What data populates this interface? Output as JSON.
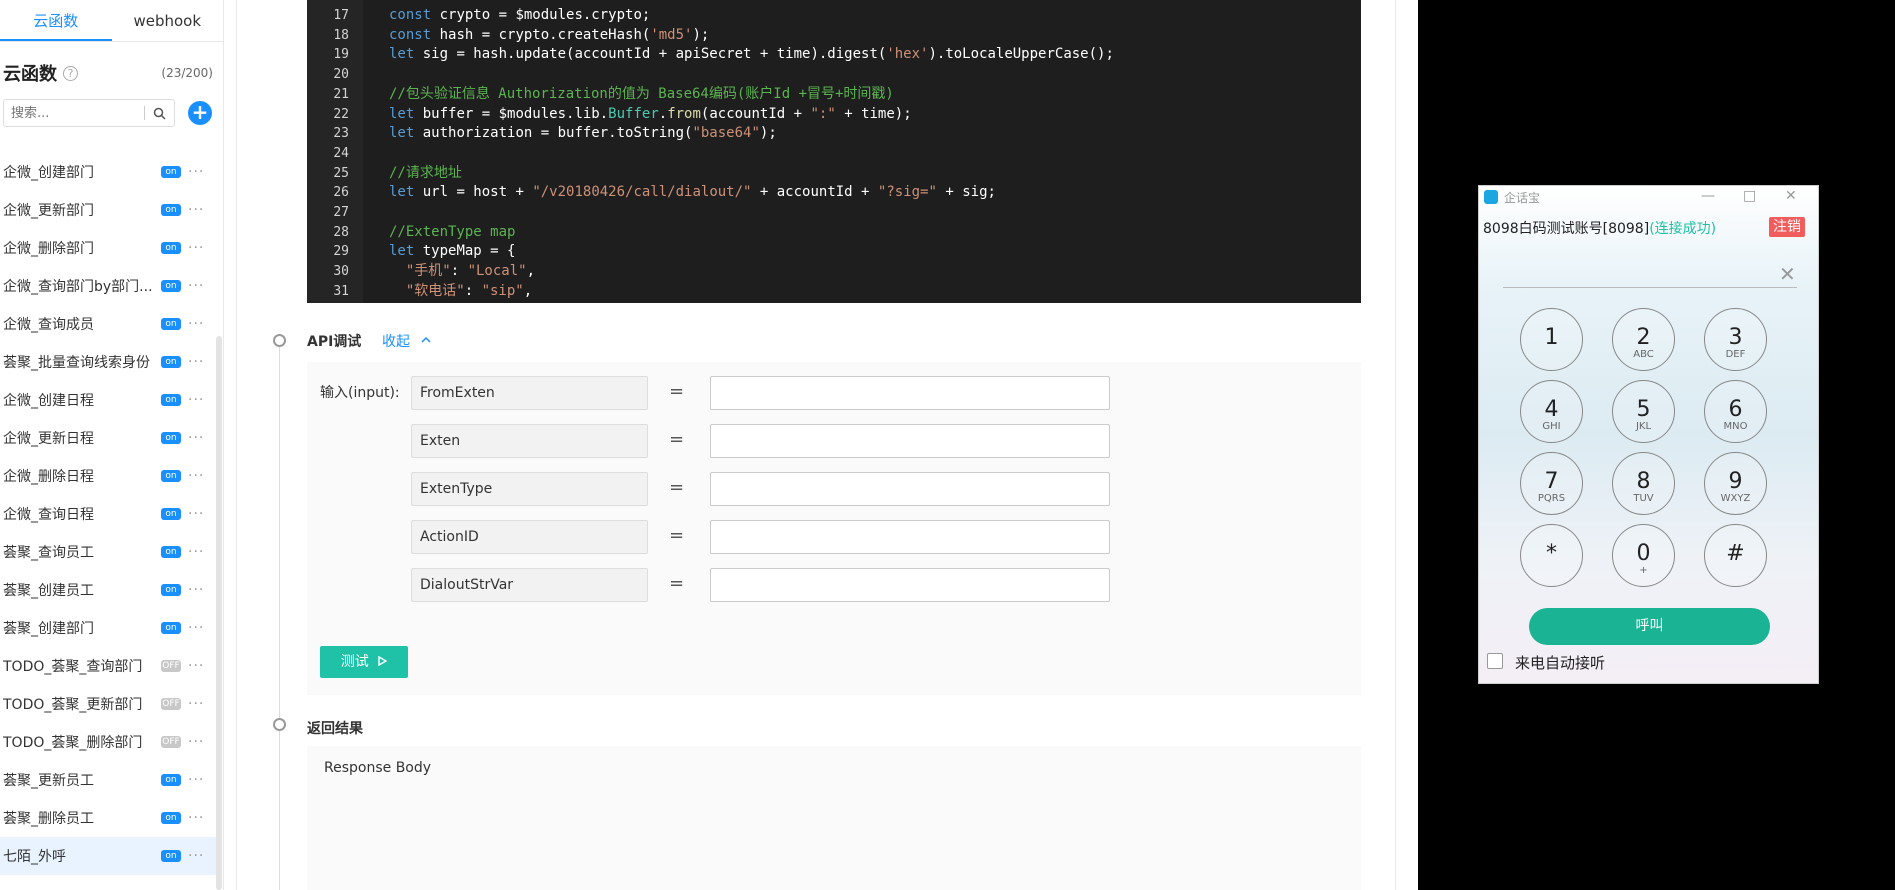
{
  "sidebar": {
    "tabs": [
      "云函数",
      "webhook"
    ],
    "title": "云函数",
    "help_icon": "?",
    "count": "(23/200)",
    "search_placeholder": "搜索...",
    "add_label": "+",
    "items": [
      {
        "label": "企微_创建部门",
        "status": "on"
      },
      {
        "label": "企微_更新部门",
        "status": "on"
      },
      {
        "label": "企微_删除部门",
        "status": "on"
      },
      {
        "label": "企微_查询部门by部门...",
        "status": "on"
      },
      {
        "label": "企微_查询成员",
        "status": "on"
      },
      {
        "label": "荟聚_批量查询线索身份",
        "status": "on"
      },
      {
        "label": "企微_创建日程",
        "status": "on"
      },
      {
        "label": "企微_更新日程",
        "status": "on"
      },
      {
        "label": "企微_删除日程",
        "status": "on"
      },
      {
        "label": "企微_查询日程",
        "status": "on"
      },
      {
        "label": "荟聚_查询员工",
        "status": "on"
      },
      {
        "label": "荟聚_创建员工",
        "status": "on"
      },
      {
        "label": "荟聚_创建部门",
        "status": "on"
      },
      {
        "label": "TODO_荟聚_查询部门",
        "status": "OFF"
      },
      {
        "label": "TODO_荟聚_更新部门",
        "status": "OFF"
      },
      {
        "label": "TODO_荟聚_删除部门",
        "status": "OFF"
      },
      {
        "label": "荟聚_更新员工",
        "status": "on"
      },
      {
        "label": "荟聚_删除员工",
        "status": "on"
      },
      {
        "label": "七陌_外呼",
        "status": "on"
      }
    ]
  },
  "code": {
    "lines": [
      {
        "n": "17",
        "text": "const crypto = $modules.crypto;"
      },
      {
        "n": "18",
        "text": "const hash = crypto.createHash('md5');"
      },
      {
        "n": "19",
        "text": "let sig = hash.update(accountId + apiSecret + time).digest('hex').toLocaleUpperCase();"
      },
      {
        "n": "20",
        "text": ""
      },
      {
        "n": "21",
        "text": "//包头验证信息 Authorization的值为 Base64编码(账户Id +冒号+时间戳)"
      },
      {
        "n": "22",
        "text": "let buffer = $modules.lib.Buffer.from(accountId + \":\" + time);"
      },
      {
        "n": "23",
        "text": "let authorization = buffer.toString(\"base64\");"
      },
      {
        "n": "24",
        "text": ""
      },
      {
        "n": "25",
        "text": "//请求地址"
      },
      {
        "n": "26",
        "text": "let url = host + \"/v20180426/call/dialout/\" + accountId + \"?sig=\" + sig;"
      },
      {
        "n": "27",
        "text": ""
      },
      {
        "n": "28",
        "text": "//ExtenType map"
      },
      {
        "n": "29",
        "text": "let typeMap = {"
      },
      {
        "n": "30",
        "text": "  \"手机\": \"Local\","
      },
      {
        "n": "31",
        "text": "  \"软电话\": \"sip\","
      }
    ]
  },
  "api_debug": {
    "title": "API调试",
    "collapse_label": "收起",
    "input_label": "输入(input):",
    "fields": [
      {
        "name": "FromExten",
        "value": ""
      },
      {
        "name": "Exten",
        "value": ""
      },
      {
        "name": "ExtenType",
        "value": ""
      },
      {
        "name": "ActionID",
        "value": ""
      },
      {
        "name": "DialoutStrVar",
        "value": ""
      }
    ],
    "equals": "=",
    "test_label": "测试"
  },
  "result": {
    "title": "返回结果",
    "body_label": "Response Body"
  },
  "softphone": {
    "title": "企话宝",
    "account": "8098白码测试账号[8098]",
    "status": "(连接成功)",
    "logout_label": "注销",
    "keys": [
      {
        "d": "1",
        "s": ""
      },
      {
        "d": "2",
        "s": "ABC"
      },
      {
        "d": "3",
        "s": "DEF"
      },
      {
        "d": "4",
        "s": "GHI"
      },
      {
        "d": "5",
        "s": "JKL"
      },
      {
        "d": "6",
        "s": "MNO"
      },
      {
        "d": "7",
        "s": "PQRS"
      },
      {
        "d": "8",
        "s": "TUV"
      },
      {
        "d": "9",
        "s": "WXYZ"
      },
      {
        "d": "*",
        "s": ""
      },
      {
        "d": "0",
        "s": "+"
      },
      {
        "d": "#",
        "s": ""
      }
    ],
    "call_label": "呼叫",
    "auto_answer_label": "来电自动接听"
  },
  "colors": {
    "accent": "#1a8fff",
    "test_button": "#1fc2a6",
    "call_button": "#1ab394",
    "logout": "#f25c5c"
  }
}
